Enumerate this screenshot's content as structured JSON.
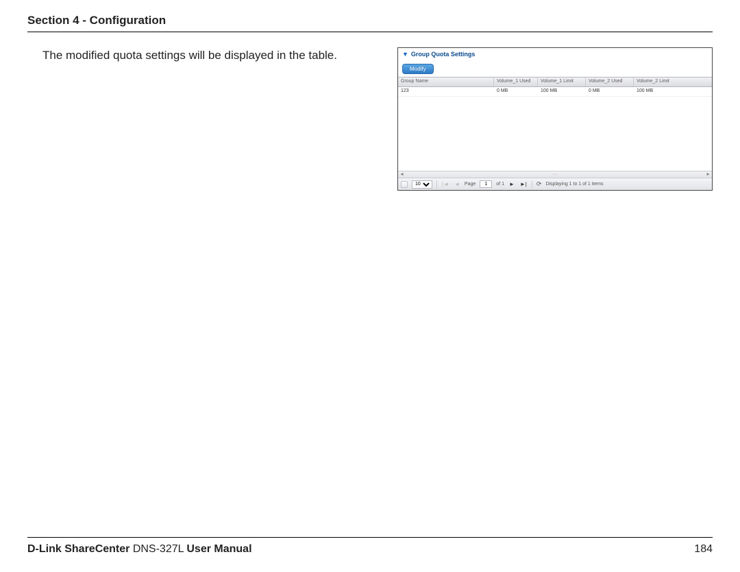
{
  "header": {
    "section_title": "Section 4 - Configuration"
  },
  "body": {
    "text": "The modified quota settings will be displayed in the table."
  },
  "panel": {
    "title": "Group Quota Settings",
    "modify_label": "Modify",
    "columns": {
      "name": "Group Name",
      "v1u": "Volume_1  Used",
      "v1l": "Volume_1  Limit",
      "v2u": "Volume_2  Used",
      "v2l": "Volume_2  Limit"
    },
    "row": {
      "name": "123",
      "v1u": "0 MB",
      "v1l": "100 MB",
      "v2u": "0 MB",
      "v2l": "100 MB"
    },
    "pager": {
      "page_size": "10",
      "page_label": "Page",
      "page_value": "1",
      "of_label": "of 1",
      "display_text": "Displaying 1 to 1 of 1 items"
    },
    "scroll": {
      "left": "◄",
      "mid": "···",
      "right": "►"
    }
  },
  "footer": {
    "brand_bold1": "D-Link ShareCenter",
    "model": " DNS-327L ",
    "brand_bold2": "User Manual",
    "page_no": "184"
  }
}
